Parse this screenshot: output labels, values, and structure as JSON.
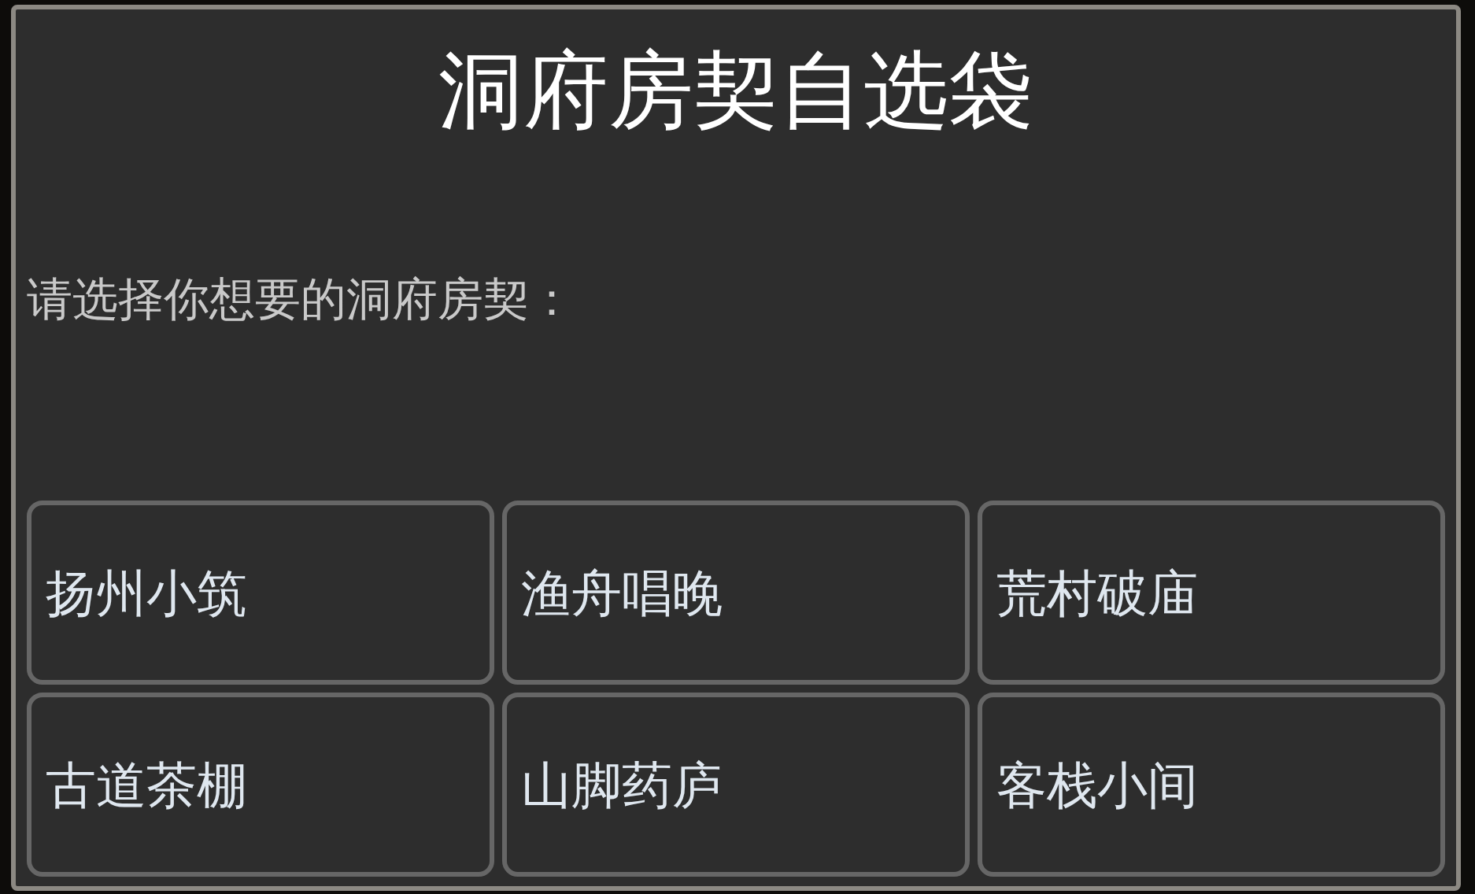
{
  "dialog": {
    "title": "洞府房契自选袋",
    "prompt": "请选择你想要的洞府房契：",
    "options": [
      {
        "label": "扬州小筑"
      },
      {
        "label": "渔舟唱晚"
      },
      {
        "label": "荒村破庙"
      },
      {
        "label": "古道茶棚"
      },
      {
        "label": "山脚药庐"
      },
      {
        "label": "客栈小间"
      }
    ]
  }
}
